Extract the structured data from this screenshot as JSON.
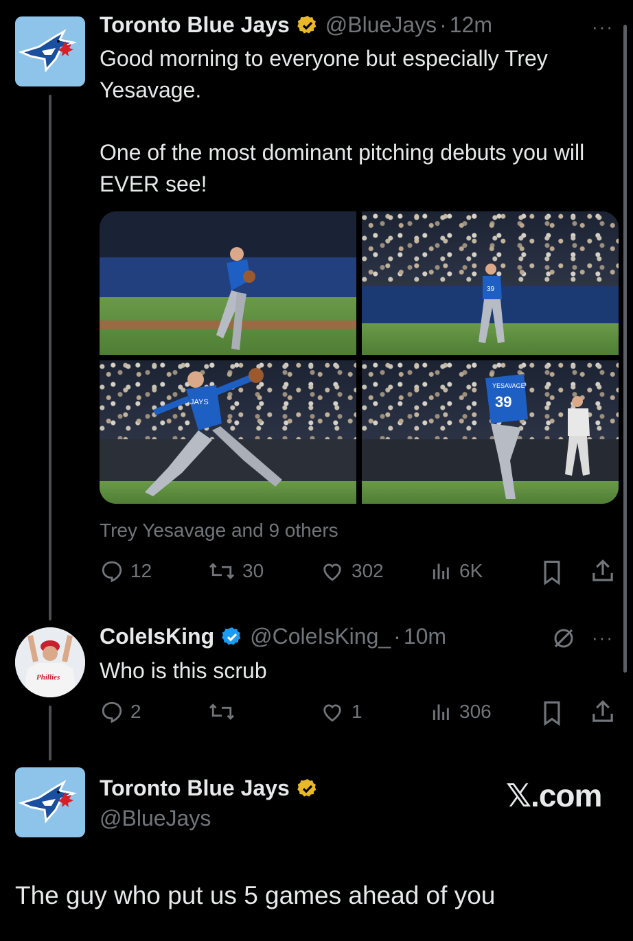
{
  "tweet1": {
    "author_name": "Toronto Blue Jays",
    "handle": "@BlueJays",
    "separator": "·",
    "time": "12m",
    "more": "···",
    "text_line1": "Good morning to everyone but especially Trey Yesavage.",
    "text_line2": "One of the most dominant pitching debuts you will EVER see!",
    "tagged": "Trey Yesavage and 9 others",
    "replies": "12",
    "reposts": "30",
    "likes": "302",
    "views": "6K",
    "photo_jersey_number": "39",
    "photo_jersey_name": "YESAVAGE",
    "photo_jersey_team": "JAYS"
  },
  "tweet2": {
    "author_name": "ColeIsKing",
    "handle": "@ColeIsKing_",
    "separator": "·",
    "time": "10m",
    "more": "···",
    "text": "Who is this scrub",
    "replies": "2",
    "reposts": "",
    "likes": "1",
    "views": "306",
    "avatar_text": "Phillies"
  },
  "tweet3": {
    "author_name": "Toronto Blue Jays",
    "handle": "@BlueJays",
    "watermark": "𝕏.com",
    "text": "The guy who put us 5 games ahead of you"
  },
  "colors": {
    "background": "#000000",
    "text": "#e7e9ea",
    "muted": "#71767b",
    "verified_gold": "#e8b829",
    "verified_blue": "#1d9bf0",
    "jays_blue": "#8ec3ea"
  }
}
